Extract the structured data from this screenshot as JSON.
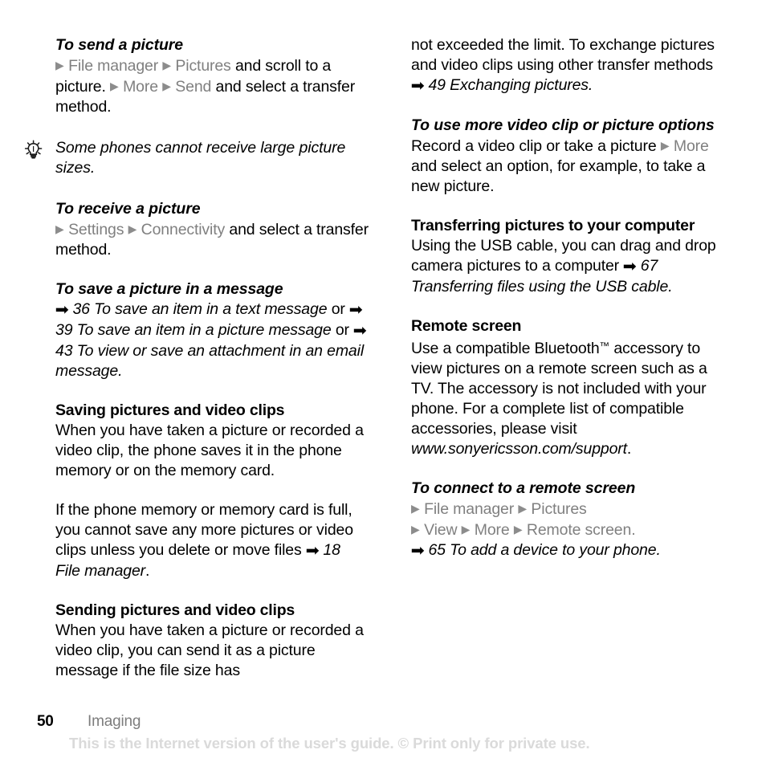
{
  "document": {
    "page_number": "50",
    "chapter": "Imaging",
    "watermark": "This is the Internet version of the user's guide. © Print only for private use."
  },
  "icons": {
    "menu_triangle": "▶",
    "xref_arrow": "➡",
    "tip_bulb": "light-bulb-icon"
  },
  "colors": {
    "menu_gray": "#808080",
    "chapter_gray": "#7d7d7d",
    "watermark_gray": "#dadada",
    "text_black": "#000000"
  },
  "left_column": {
    "send_picture": {
      "heading": "To send a picture",
      "line1_menu1": "File manager",
      "line1_menu2": "Pictures",
      "line1_tail": "and scroll",
      "line2_head": "to a picture.",
      "line2_menu1": "More",
      "line2_menu2": "Send",
      "line2_tail": "and select",
      "line3": "a transfer method."
    },
    "tip": {
      "text": "Some phones cannot receive large picture sizes."
    },
    "receive_picture": {
      "heading": "To receive a picture",
      "menu1": "Settings",
      "menu2": "Connectivity",
      "tail": "and select",
      "line2": "a transfer method."
    },
    "save_picture": {
      "heading": "To save a picture in a message",
      "ref1_page": "36",
      "ref1_title": "To save an item in a text message",
      "or1": "or",
      "ref2_page": "39",
      "ref2_title": "To save an item in a picture message",
      "or2": "or",
      "ref3_page": "43",
      "ref3_title": "To view or save an attachment in an email message",
      "period": "."
    },
    "saving": {
      "heading": "Saving pictures and video clips",
      "paragraph1": "When you have taken a picture or recorded a video clip, the phone saves it in the phone memory or on the memory card.",
      "paragraph2_head": "If the phone memory or memory card is full, you cannot save any more pictures or video clips unless you delete or move files",
      "paragraph2_ref_page": "18",
      "paragraph2_ref_title": "File manager",
      "paragraph2_tail": "."
    },
    "sending": {
      "heading": "Sending pictures and video clips",
      "paragraph": "When you have taken a picture or recorded a video clip, you can send it as a picture message if the file size has"
    }
  },
  "right_column": {
    "continuation": {
      "head": "not exceeded the limit. To exchange pictures and video clips using other transfer methods",
      "ref_page": "49",
      "ref_title": "Exchanging pictures",
      "tail": "."
    },
    "more_options": {
      "heading": "To use more video clip or picture options",
      "line1": "Record a video clip or take a picture",
      "menu1": "More",
      "line2_tail": "and select an option, for example, to take a new picture."
    },
    "transferring": {
      "heading": "Transferring pictures to your computer",
      "paragraph_head": "Using the USB cable, you can drag and drop camera pictures to a computer",
      "ref_page": "67",
      "ref_title": "Transferring files using the USB cable",
      "tail": "."
    },
    "remote_screen": {
      "heading": "Remote screen",
      "paragraph_part1": "Use a compatible Bluetooth",
      "trademark": "™",
      "paragraph_part2": "accessory to view pictures on a remote screen such as a TV. The accessory is not included with your phone. For a complete list of compatible accessories, please visit",
      "url": "www.sonyericsson.com/support",
      "url_tail": "."
    },
    "connect_remote": {
      "heading": "To connect to a remote screen",
      "line1_menu1": "File manager",
      "line1_menu2": "Pictures",
      "line2_menu1": "View",
      "line2_menu2": "More",
      "line2_menu3": "Remote screen",
      "line2_tail": ".",
      "ref_page": "65",
      "ref_title": "To add a device to your phone",
      "ref_tail": "."
    }
  }
}
